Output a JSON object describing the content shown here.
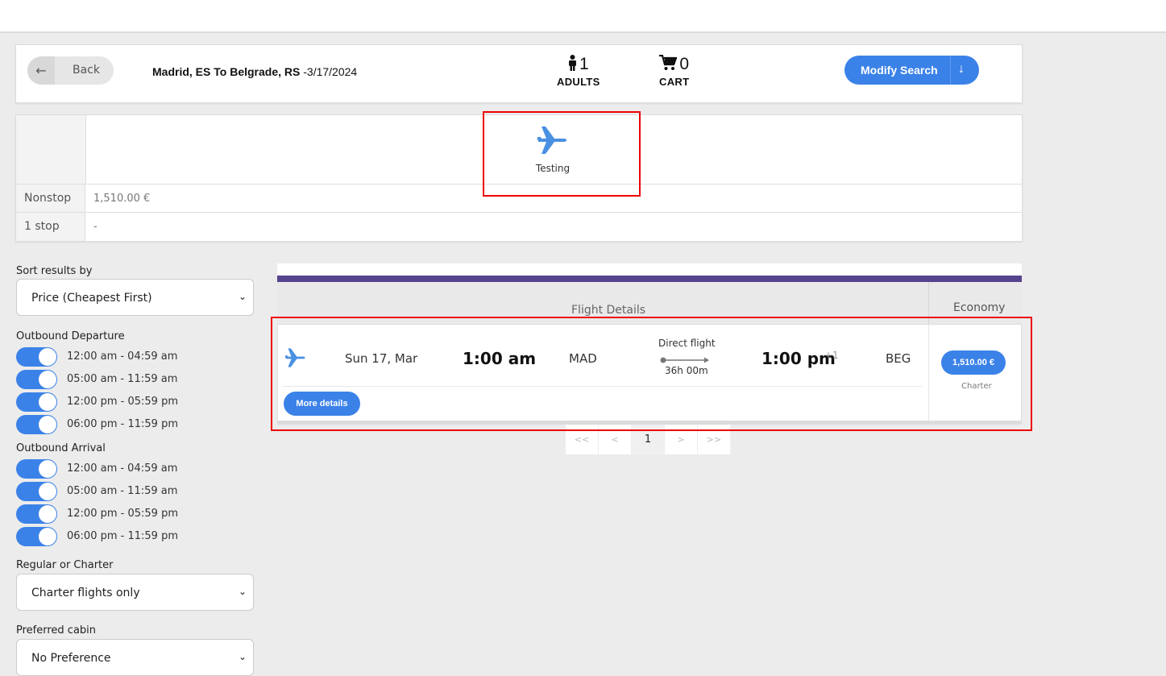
{
  "header": {
    "back_label": "Back",
    "route_from": "Madrid, ES",
    "route_to_word": "To",
    "route_to": "Belgrade, RS",
    "route_date": " -3/17/2024",
    "adults_count": "1",
    "adults_label": "ADULTS",
    "cart_count": "0",
    "cart_label": "CART",
    "modify_label": "Modify Search"
  },
  "matrix": {
    "airline_name": "Testing",
    "rows": [
      {
        "label": "Nonstop",
        "value": "1,510.00 €"
      },
      {
        "label": "1 stop",
        "value": "-"
      }
    ]
  },
  "filters": {
    "sort_label": "Sort results by",
    "sort_value": "Price (Cheapest First)",
    "outbound_departure_label": "Outbound Departure",
    "departure_slots": [
      "12:00 am - 04:59 am",
      "05:00 am - 11:59 am",
      "12:00 pm - 05:59 pm",
      "06:00 pm - 11:59 pm"
    ],
    "outbound_arrival_label": "Outbound Arrival",
    "arrival_slots": [
      "12:00 am - 04:59 am",
      "05:00 am - 11:59 am",
      "12:00 pm - 05:59 pm",
      "06:00 pm - 11:59 pm"
    ],
    "regular_charter_label": "Regular or Charter",
    "regular_charter_value": "Charter flights only",
    "cabin_label": "Preferred cabin",
    "cabin_value": "No Preference"
  },
  "results": {
    "flight_details_header": "Flight Details",
    "economy_header": "Economy",
    "flight": {
      "date": "Sun 17, Mar",
      "depart_time": "1:00 am",
      "origin": "MAD",
      "stop_text": "Direct flight",
      "duration": "36h 00m",
      "arrive_time": "1:00 pm",
      "day_offset": "+1",
      "destination": "BEG",
      "more_details_label": "More details",
      "price": "1,510.00 €",
      "fare_type": "Charter"
    }
  },
  "pager": {
    "first": "<<",
    "prev": "<",
    "page": "1",
    "next": ">",
    "last": ">>"
  },
  "colors": {
    "accent": "#3b82e8",
    "band": "#56438e",
    "highlight": "#ee0000"
  }
}
